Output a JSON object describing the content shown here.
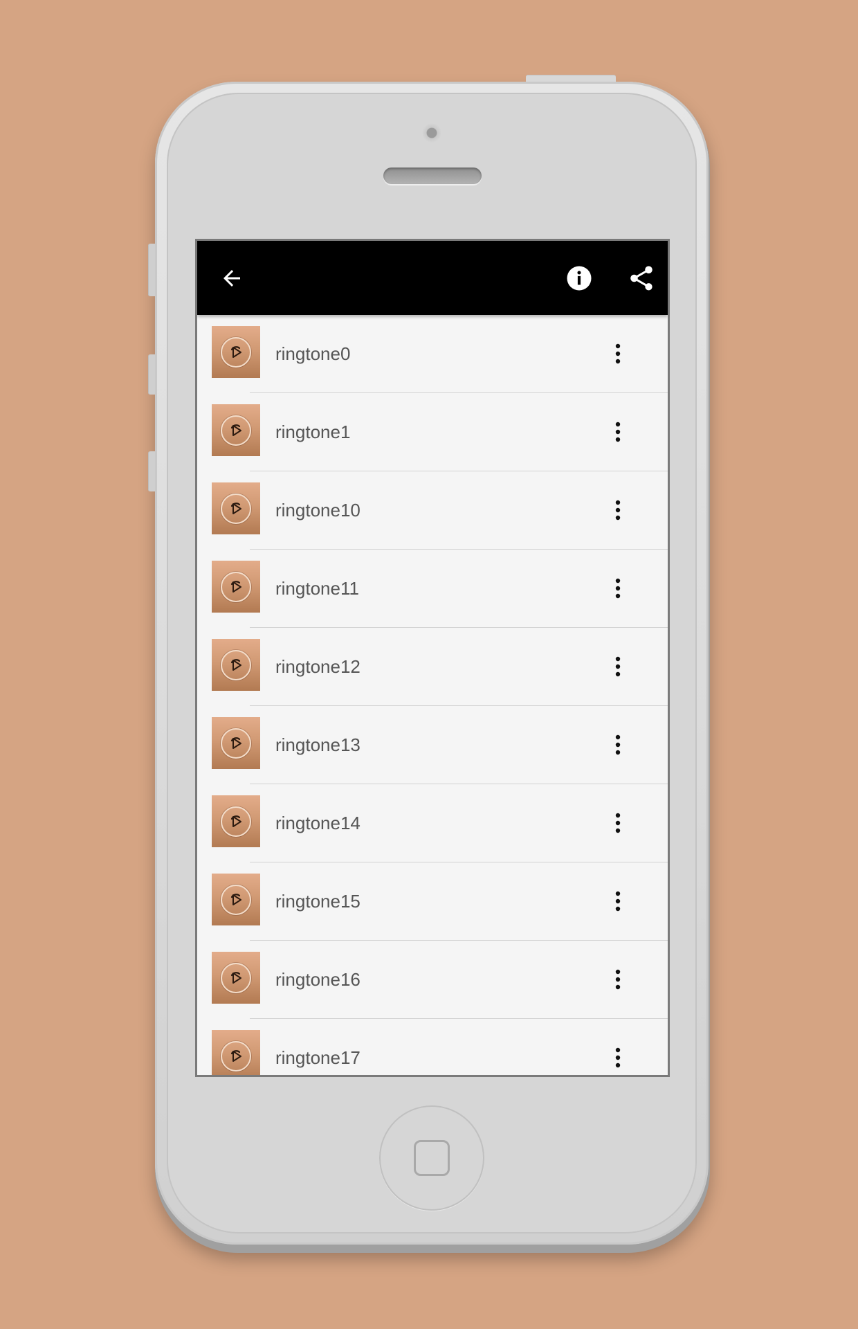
{
  "toolbar": {
    "back_icon": "arrow-back-icon",
    "info_icon": "info-icon",
    "share_icon": "share-icon",
    "background": "#000000"
  },
  "ringtones": [
    {
      "label": "ringtone0"
    },
    {
      "label": "ringtone1"
    },
    {
      "label": "ringtone10"
    },
    {
      "label": "ringtone11"
    },
    {
      "label": "ringtone12"
    },
    {
      "label": "ringtone13"
    },
    {
      "label": "ringtone14"
    },
    {
      "label": "ringtone15"
    },
    {
      "label": "ringtone16"
    },
    {
      "label": "ringtone17"
    }
  ],
  "colors": {
    "page_background": "#d5a483",
    "list_background": "#f5f5f5",
    "label_text": "#555555"
  }
}
